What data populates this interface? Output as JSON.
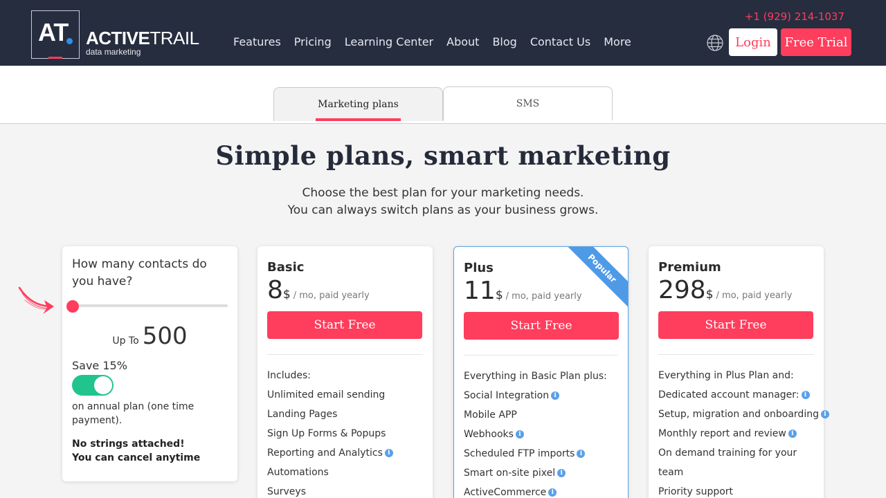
{
  "header": {
    "logo_mark": "AT",
    "logo_name_bold": "ACTIVE",
    "logo_name_rest": "TRAIL",
    "logo_sub": "data marketing",
    "nav": [
      "Features",
      "Pricing",
      "Learning Center",
      "About",
      "Blog",
      "Contact Us",
      "More"
    ],
    "phone": "+1 (929) 214-1037",
    "login": "Login",
    "free_trial": "Free Trial",
    "icons": {
      "language": "globe-icon"
    }
  },
  "tabs": [
    {
      "label": "Marketing plans",
      "active": true
    },
    {
      "label": "SMS",
      "active": false
    }
  ],
  "headline": "Simple plans, smart marketing",
  "subheadline": [
    "Choose the best plan for your marketing needs.",
    "You can always switch plans as your business grows."
  ],
  "contacts": {
    "question": "How many contacts do you have?",
    "slider_value": 500,
    "up_to_label": "Up To",
    "up_to_value": "500",
    "save_label": "Save 15%",
    "annual_toggle_on": true,
    "annual_text": "on annual plan (one time payment).",
    "no_strings": "No strings attached!",
    "cancel": "You can cancel anytime"
  },
  "plans": [
    {
      "name": "Basic",
      "price": "8",
      "currency": "$",
      "period": "/ mo, paid yearly",
      "cta": "Start Free",
      "features": [
        {
          "text": "Includes:",
          "info": false
        },
        {
          "text": "Unlimited email sending",
          "info": false
        },
        {
          "text": "Landing Pages",
          "info": false
        },
        {
          "text": "Sign Up Forms & Popups",
          "info": false
        },
        {
          "text": "Reporting and Analytics",
          "info": true
        },
        {
          "text": "Automations",
          "info": false
        },
        {
          "text": "Surveys",
          "info": false
        }
      ]
    },
    {
      "name": "Plus",
      "price": "11",
      "currency": "$",
      "period": "/ mo, paid yearly",
      "cta": "Start Free",
      "badge": "Popular",
      "features": [
        {
          "text": "Everything in Basic Plan plus:",
          "info": false
        },
        {
          "text": "Social Integration",
          "info": true
        },
        {
          "text": "Mobile APP",
          "info": false
        },
        {
          "text": "Webhooks",
          "info": true
        },
        {
          "text": "Scheduled FTP imports",
          "info": true
        },
        {
          "text": "Smart on-site pixel",
          "info": true
        },
        {
          "text": "ActiveCommerce",
          "info": true
        }
      ]
    },
    {
      "name": "Premium",
      "price": "298",
      "currency": "$",
      "period": "/ mo, paid yearly",
      "cta": "Start Free",
      "features": [
        {
          "text": "Everything in Plus Plan and:",
          "info": false
        },
        {
          "text": "Dedicated account manager:",
          "info": true
        },
        {
          "text": "Setup, migration and onboarding",
          "info": true
        },
        {
          "text": "Monthly report and review",
          "info": true
        },
        {
          "text": "On demand training for your team",
          "info": false
        },
        {
          "text": "Priority support",
          "info": false
        }
      ]
    }
  ],
  "colors": {
    "accent": "#ff3d5c",
    "header_bg": "#262d3f",
    "toggle_on": "#22c48e",
    "info_blue": "#5aa0e8"
  }
}
